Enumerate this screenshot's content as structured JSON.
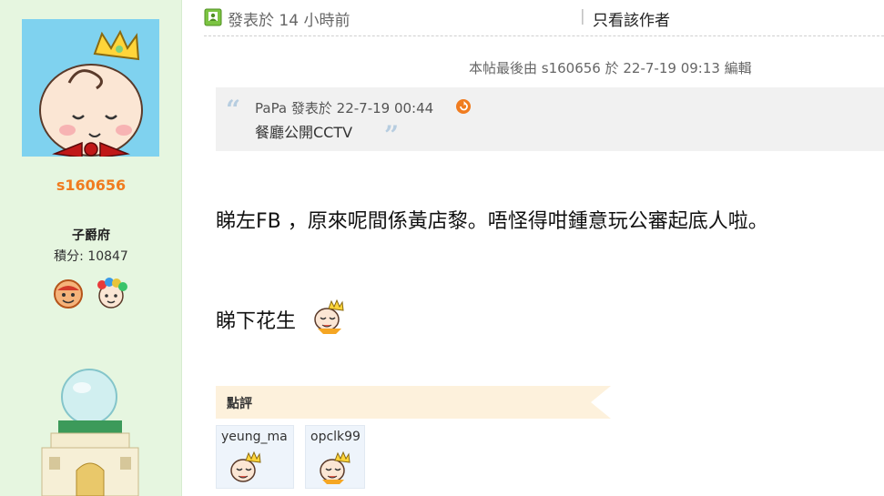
{
  "profile": {
    "username": "s160656",
    "rank": "子爵府",
    "points": "積分: 10847"
  },
  "post": {
    "time": "發表於 14 小時前",
    "separator": "|",
    "author_only": "只看該作者",
    "edit_note": "本帖最後由 s160656 於 22-7-19 09:13 編輯",
    "quote": {
      "meta": "PaPa 發表於 22-7-19 00:44",
      "text": "餐廳公開CCTV"
    },
    "lines": [
      "睇左FB ，原來呢間係黃店黎。唔怪得咁鍾意玩公審起底人啦。",
      "睇下花生"
    ]
  },
  "ratings": {
    "label": "點評",
    "users": [
      "yeung_ma",
      "opclk99"
    ]
  },
  "colors": {
    "sidebar_bg": "#e6f6e0",
    "username": "#f07c20",
    "quote_bg": "#f1f1f1",
    "comment_bar": "#fdf1dc",
    "rater_bg": "#eef4fb"
  }
}
